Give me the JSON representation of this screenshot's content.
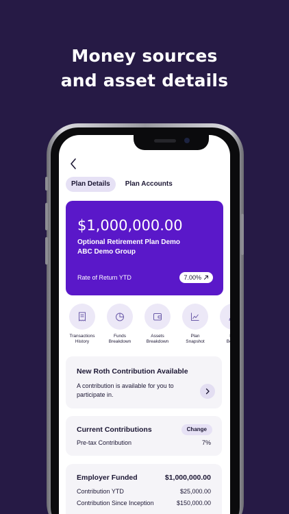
{
  "headline": {
    "line1": "Money sources",
    "line2": "and asset details"
  },
  "tabs": [
    {
      "label": "Plan Details",
      "active": true
    },
    {
      "label": "Plan Accounts",
      "active": false
    }
  ],
  "hero": {
    "amount": "$1,000,000.00",
    "plan_name": "Optional Retirement Plan Demo",
    "group": "ABC Demo Group",
    "ror_label": "Rate of Return YTD",
    "ror_value": "7.00%",
    "color": "#5a18c9"
  },
  "actions": [
    {
      "line1": "Transactions",
      "line2": "History",
      "icon": "receipt-icon"
    },
    {
      "line1": "Funds",
      "line2": "Breakdown",
      "icon": "pie-chart-icon"
    },
    {
      "line1": "Assets",
      "line2": "Breakdown",
      "icon": "wallet-icon"
    },
    {
      "line1": "Plan",
      "line2": "Snapshot",
      "icon": "line-chart-icon"
    },
    {
      "line1": "Pla",
      "line2": "Benefi",
      "icon": "person-icon"
    }
  ],
  "roth_card": {
    "title": "New Roth Contribution Available",
    "text1": "A contribution is available for you to",
    "text2": "participate in."
  },
  "contributions_card": {
    "title": "Current Contributions",
    "change_label": "Change",
    "row_label": "Pre-tax Contribution",
    "row_value": "7%"
  },
  "employer_card": {
    "title": "Employer Funded",
    "total": "$1,000,000.00",
    "row1_label": "Contribution YTD",
    "row1_value": "$25,000.00",
    "row2_label": "Contribution Since Inception",
    "row2_value": "$150,000.00"
  },
  "colors": {
    "background": "#261a45",
    "accent": "#5a18c9",
    "chip": "#e6e1f5"
  }
}
